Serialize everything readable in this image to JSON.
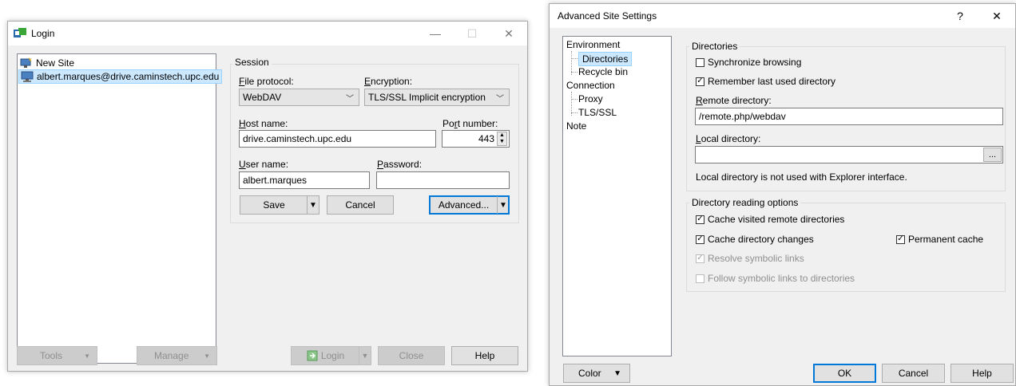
{
  "login": {
    "title": "Login",
    "sites": [
      {
        "label": "New Site",
        "icon": "new-site-icon"
      },
      {
        "label": "albert.marques@drive.caminstech.upc.edu",
        "icon": "computer-icon",
        "selected": true
      }
    ],
    "session_label": "Session",
    "file_protocol_label": "File protocol:",
    "file_protocol_value": "WebDAV",
    "encryption_label": "Encryption:",
    "encryption_value": "TLS/SSL Implicit encryption",
    "host_label": "Host name:",
    "host_value": "drive.caminstech.upc.edu",
    "port_label": "Port number:",
    "port_value": "443",
    "user_label": "User name:",
    "user_value": "albert.marques",
    "password_label": "Password:",
    "password_value": "",
    "save": "Save",
    "cancel": "Cancel",
    "advanced": "Advanced...",
    "tools": "Tools",
    "manage": "Manage",
    "login_btn": "Login",
    "close": "Close",
    "help": "Help"
  },
  "advanced": {
    "title": "Advanced Site Settings",
    "help_glyph": "?",
    "close_glyph": "✕",
    "tree": [
      {
        "label": "Environment",
        "level": 0
      },
      {
        "label": "Directories",
        "level": 1,
        "selected": true
      },
      {
        "label": "Recycle bin",
        "level": 1
      },
      {
        "label": "Connection",
        "level": 0
      },
      {
        "label": "Proxy",
        "level": 1
      },
      {
        "label": "TLS/SSL",
        "level": 1
      },
      {
        "label": "Note",
        "level": 0
      }
    ],
    "directories_group": "Directories",
    "sync_browsing": {
      "label": "Synchronize browsing",
      "checked": false
    },
    "remember_dir": {
      "label": "Remember last used directory",
      "checked": true
    },
    "remote_dir_label": "Remote directory:",
    "remote_dir_value": "/remote.php/webdav",
    "local_dir_label": "Local directory:",
    "local_dir_value": "",
    "browse": "...",
    "local_note": "Local directory is not used with Explorer interface.",
    "reading_group": "Directory reading options",
    "cache_visited": {
      "label": "Cache visited remote directories",
      "checked": true
    },
    "cache_changes": {
      "label": "Cache directory changes",
      "checked": true
    },
    "permanent_cache": {
      "label": "Permanent cache",
      "checked": true
    },
    "resolve_links": {
      "label": "Resolve symbolic links",
      "checked": true,
      "disabled": true
    },
    "follow_links": {
      "label": "Follow symbolic links to directories",
      "checked": false,
      "disabled": true
    },
    "color": "Color",
    "ok": "OK",
    "cancel": "Cancel",
    "help": "Help"
  },
  "colors": {
    "accent": "#0078d7",
    "selection": "#cce8ff",
    "window_bg": "#f0f0f0"
  }
}
